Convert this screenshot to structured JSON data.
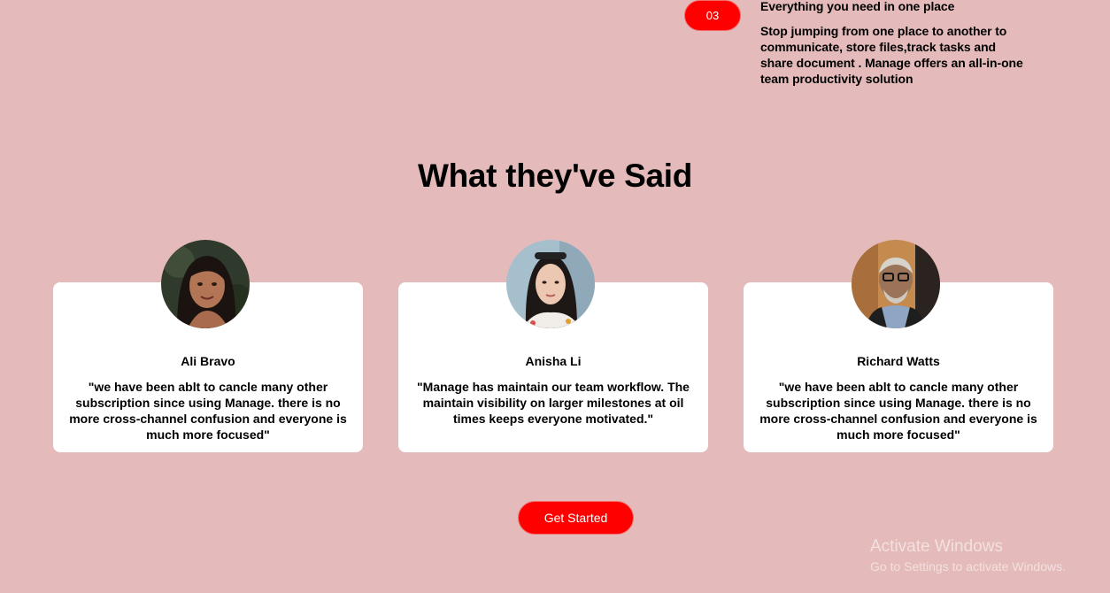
{
  "feature": {
    "number": "03",
    "title": "Everything you need in one place",
    "description": "Stop jumping from one place to another to communicate, store files,track tasks and share document . Manage offers an all-in-one team productivity solution",
    "accent_color": "#ff0000"
  },
  "testimonials": {
    "heading": "What they've Said",
    "items": [
      {
        "name": "Ali Bravo",
        "quote": "\"we have been ablt to cancle many other subscription since using Manage. there is no more cross-channel confusion and everyone is much more focused\""
      },
      {
        "name": "Anisha Li",
        "quote": "\"Manage has maintain our team workflow. The maintain visibility on larger milestones at oil times keeps everyone motivated.\""
      },
      {
        "name": "Richard Watts",
        "quote": "\"we have been ablt to cancle many other subscription since using Manage. there is no more cross-channel confusion and everyone is much more focused\""
      }
    ]
  },
  "cta": {
    "label": "Get Started"
  },
  "os_watermark": {
    "title": "Activate Windows",
    "subtitle": "Go to Settings to activate Windows."
  },
  "colors": {
    "background": "#e4bbba",
    "card": "#ffffff",
    "accent": "#ff0000"
  }
}
